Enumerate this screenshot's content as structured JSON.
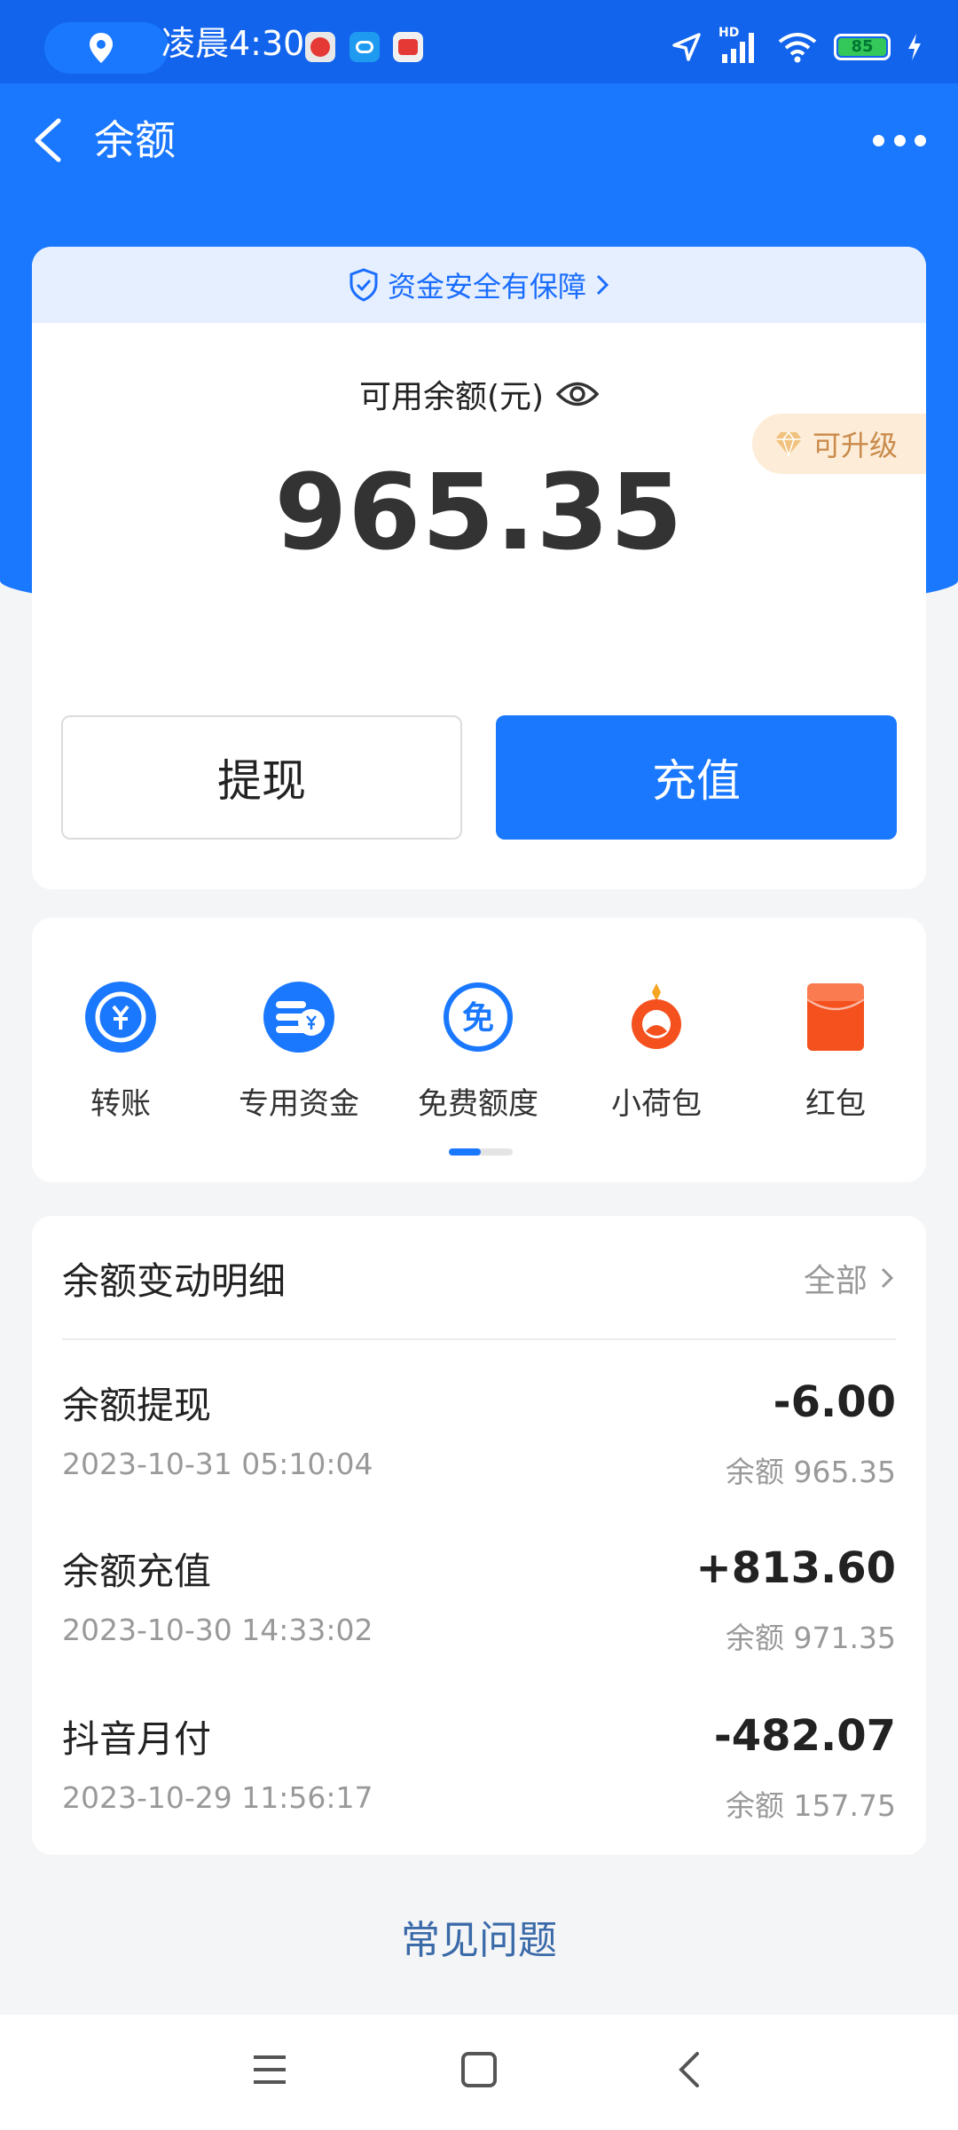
{
  "status_bar": {
    "time": "凌晨4:30",
    "battery": "85",
    "network_label": "HD",
    "icons": [
      "location-pin-icon",
      "app-badge-icon",
      "app-chat-icon",
      "app-delivery-icon",
      "navigation-arrow-icon",
      "signal-icon",
      "wifi-icon",
      "battery-icon",
      "charging-icon"
    ]
  },
  "header": {
    "title": "余额",
    "back_icon": "chevron-left-icon",
    "more_icon": "more-dots-icon"
  },
  "balance_card": {
    "safety_text": "资金安全有保障",
    "label": "可用余额(元)",
    "amount": "965.35",
    "upgrade": "可升级",
    "withdraw": "提现",
    "recharge": "充值"
  },
  "services": [
    {
      "label": "转账",
      "icon": "transfer-icon"
    },
    {
      "label": "专用资金",
      "icon": "dedicated-funds-icon"
    },
    {
      "label": "免费额度",
      "icon": "free-quota-icon"
    },
    {
      "label": "小荷包",
      "icon": "small-pouch-icon"
    },
    {
      "label": "红包",
      "icon": "red-envelope-icon"
    }
  ],
  "details": {
    "title": "余额变动明细",
    "all": "全部",
    "records": [
      {
        "title": "余额提现",
        "time": "2023-10-31 05:10:04",
        "amount": "-6.00",
        "balance": "余额 965.35"
      },
      {
        "title": "余额充值",
        "time": "2023-10-30 14:33:02",
        "amount": "+813.60",
        "balance": "余额 971.35"
      },
      {
        "title": "抖音月付",
        "time": "2023-10-29 11:56:17",
        "amount": "-482.07",
        "balance": "余额 157.75"
      }
    ]
  },
  "faq": "常见问题",
  "colors": {
    "primary": "#1a78ff",
    "statusbar": "#1264ec",
    "upgrade_text": "#c98a4a",
    "red_envelope": "#f4511e"
  }
}
